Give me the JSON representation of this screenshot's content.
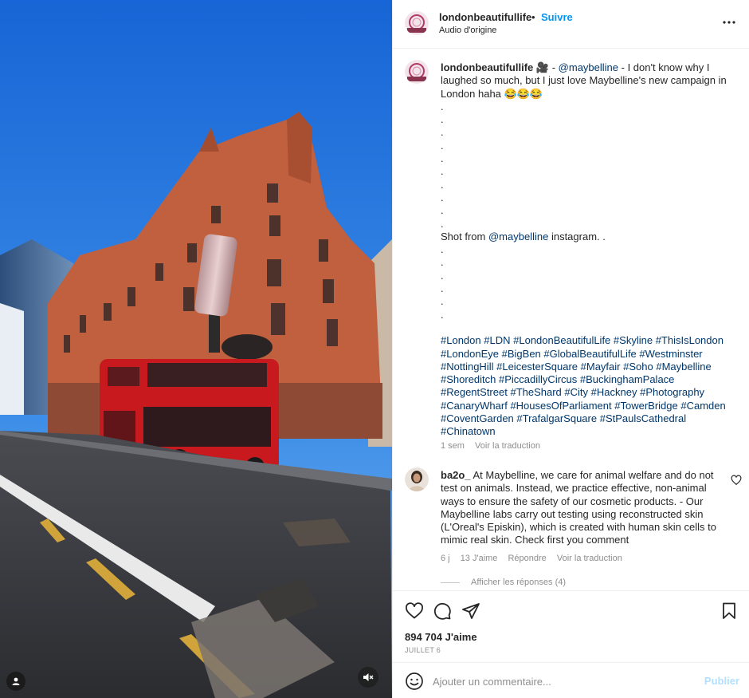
{
  "post": {
    "username": "londonbeautifullife",
    "follow_separator": "•",
    "follow_label": "Suivre",
    "audio_label": "Audio d'origine",
    "more_icon": "more-horizontal-icon"
  },
  "caption": {
    "username": "londonbeautifullife",
    "camera_emoji": "🎥",
    "dash": "-",
    "mention": "@maybelline",
    "text": "- I don't know why I laughed so much, but I just love Maybelline's new campaign in London haha 😂😂😂",
    "dots_top": [
      ".",
      ".",
      ".",
      ".",
      ".",
      ".",
      ".",
      ".",
      ".",
      "."
    ],
    "shot_from_prefix": "Shot from",
    "shot_from_mention": "@maybelline",
    "shot_from_suffix": "instagram. .",
    "dots_bottom": [
      ".",
      ".",
      ".",
      ".",
      ".",
      "."
    ],
    "hashtags": [
      "#London",
      "#LDN",
      "#LondonBeautifulLife",
      "#Skyline",
      "#ThisIsLondon",
      "#LondonEye",
      "#BigBen",
      "#GlobalBeautifulLife",
      "#Westminster",
      "#NottingHill",
      "#LeicesterSquare",
      "#Mayfair",
      "#Soho",
      "#Maybelline",
      "#Shoreditch",
      "#PiccadillyCircus",
      "#BuckinghamPalace",
      "#RegentStreet",
      "#TheShard",
      "#City",
      "#Hackney",
      "#Photography",
      "#CanaryWharf",
      "#HousesOfParliament",
      "#TowerBridge",
      "#Camden",
      "#CoventGarden",
      "#TrafalgarSquare",
      "#StPaulsCathedral",
      "#Chinatown"
    ],
    "time": "1 sem",
    "translate": "Voir la traduction"
  },
  "comment": {
    "username": "ba2o_",
    "text": "At Maybelline, we care for animal welfare and do not test on animals. Instead, we practice effective, non-animal ways to ensure the safety of our cosmetic products. - Our Maybelline labs carry out testing using reconstructed skin (L'Oreal's Episkin), which is created with human skin cells to mimic real skin. Check first you comment",
    "time": "6 j",
    "likes": "13 J'aime",
    "reply": "Répondre",
    "translate": "Voir la traduction",
    "show_replies": "Afficher les réponses (4)"
  },
  "actions": {
    "like_icon": "heart-icon",
    "comment_icon": "comment-icon",
    "share_icon": "share-icon",
    "save_icon": "bookmark-icon",
    "likes_count": "894 704 J'aime",
    "date": "JUILLET 6"
  },
  "add_comment": {
    "placeholder": "Ajouter un commentaire...",
    "publish_label": "Publier",
    "emoji_icon": "emoji-icon"
  },
  "media": {
    "mute_icon": "muted-speaker-icon",
    "profile_icon": "user-icon"
  },
  "colors": {
    "link_blue": "#0095f6",
    "hashtag_blue": "#00376b",
    "muted_gray": "#8e8e8e",
    "publish_disabled": "#b2dffc"
  }
}
